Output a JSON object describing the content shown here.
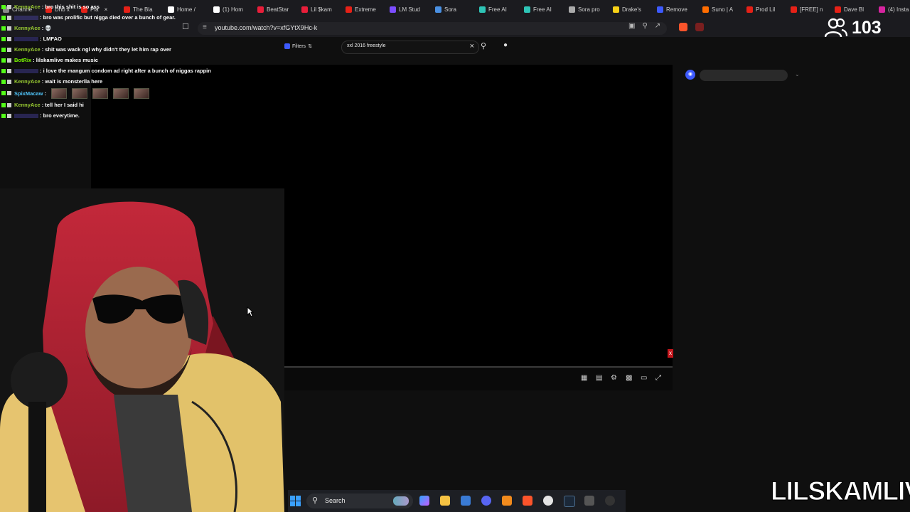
{
  "browser": {
    "tabs": [
      {
        "label": "Channe",
        "color": "#888888"
      },
      {
        "label": "Dnb x",
        "color": "#e62117"
      },
      {
        "label": "Pla",
        "color": "#e62117"
      },
      {
        "label": "The Bla",
        "color": "#e62117"
      },
      {
        "label": "Home /",
        "color": "#ffffff"
      },
      {
        "label": "(1) Hom",
        "color": "#ffffff"
      },
      {
        "label": "BeatStar",
        "color": "#e91e3a"
      },
      {
        "label": "Lil $kam",
        "color": "#e91e3a"
      },
      {
        "label": "Extreme",
        "color": "#e62117"
      },
      {
        "label": "LM Stud",
        "color": "#7c4dff"
      },
      {
        "label": "Sora",
        "color": "#4a90e2"
      },
      {
        "label": "Free AI",
        "color": "#2ec4b6"
      },
      {
        "label": "Free AI",
        "color": "#2ec4b6"
      },
      {
        "label": "Sora pro",
        "color": "#aaaaaa"
      },
      {
        "label": "Drake's",
        "color": "#f7d117"
      },
      {
        "label": "Remove",
        "color": "#3d5afe"
      },
      {
        "label": "Suno | A",
        "color": "#ff6d00"
      },
      {
        "label": "Prod Lil",
        "color": "#e62117"
      },
      {
        "label": "[FREE] n",
        "color": "#e62117"
      },
      {
        "label": "Dave Bl",
        "color": "#e62117"
      },
      {
        "label": "(4) Insta",
        "color": "#d6249f"
      }
    ],
    "url": "youtube.com/watch?v=xfGYtX9Hc-k"
  },
  "viewers": {
    "count": "103"
  },
  "youtube": {
    "filters_label": "Filters",
    "search_query": "xxl 2016 freestyle"
  },
  "chat": {
    "messages": [
      {
        "user": "KennyAce",
        "user_color": "#9acd32",
        "text": ": bro this shit is so ass"
      },
      {
        "user": "",
        "user_color": "#5a4fcf",
        "text": ": bro was prolific but nigga died over a bunch of gear."
      },
      {
        "user": "KennyAce",
        "user_color": "#9acd32",
        "text": ": 💀"
      },
      {
        "user": "",
        "user_color": "#5a4fcf",
        "text": ": LMFAO"
      },
      {
        "user": "KennyAce",
        "user_color": "#9acd32",
        "text": ": shit was wack ngl why didn't they let him rap over"
      },
      {
        "user": "BotRix",
        "user_color": "#7cfc00",
        "text": ": lilskamlive makes music"
      },
      {
        "user": "",
        "user_color": "#5a4fcf",
        "text": ": i love the mangum condom ad right after a bunch of niggas rappin"
      },
      {
        "user": "KennyAce",
        "user_color": "#9acd32",
        "text": ": wait is monsterlla here"
      },
      {
        "user": "SpixMacaw",
        "user_color": "#4fc3f7",
        "text": ":",
        "emotes": 5
      },
      {
        "user": "KennyAce",
        "user_color": "#9acd32",
        "text": ": tell her I said hi"
      },
      {
        "user": "",
        "user_color": "#5a4fcf",
        "text": ": bro everytime."
      }
    ]
  },
  "taskbar": {
    "search_label": "Search"
  },
  "watermark": "LILSKAMLIVE"
}
